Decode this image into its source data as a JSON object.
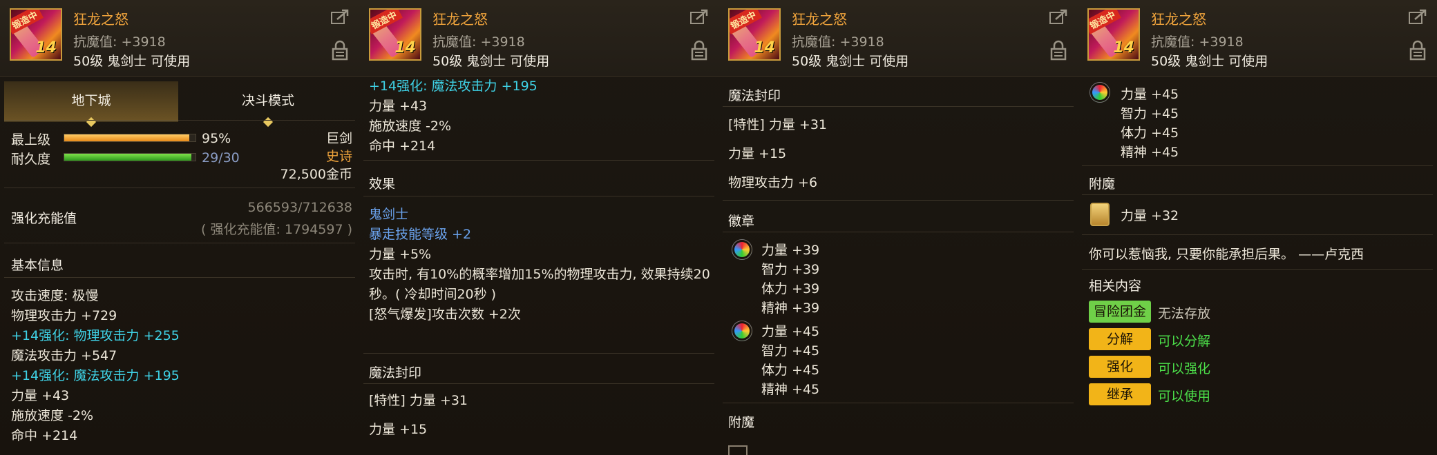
{
  "item": {
    "name": "狂龙之怒",
    "badge": "锻造中",
    "level_overlay": "14",
    "stat": "抗魔值: +3918",
    "requirement": "50级 鬼剑士 可使用"
  },
  "panel1": {
    "tabs": [
      "地下城",
      "决斗模式"
    ],
    "grade_label": "最上级",
    "grade_value": "95%",
    "grade_fraction": 0.95,
    "durability_label": "耐久度",
    "durability_value": "29/30",
    "durability_fraction": 0.967,
    "weapon_type": "巨剑",
    "rarity": "史诗",
    "price": "72,500金币",
    "charge_label": "强化充能值",
    "charge_value": "566593/712638",
    "charge_total": "( 强化充能值: 1794597 )",
    "basic_info_title": "基本信息",
    "lines": [
      {
        "text": "攻击速度: 极慢",
        "color": "white"
      },
      {
        "text": "物理攻击力 +729",
        "color": "white"
      },
      {
        "text": "+14强化: 物理攻击力 +255",
        "color": "cyan"
      },
      {
        "text": "魔法攻击力 +547",
        "color": "white"
      },
      {
        "text": "+14强化: 魔法攻击力 +195",
        "color": "cyan"
      },
      {
        "text": "力量 +43",
        "color": "white"
      },
      {
        "text": "施放速度 -2%",
        "color": "white"
      },
      {
        "text": "命中 +214",
        "color": "white"
      }
    ]
  },
  "panel2": {
    "top_lines": [
      {
        "text": "+14强化: 魔法攻击力 +195",
        "color": "cyan"
      },
      {
        "text": "力量 +43",
        "color": "white"
      },
      {
        "text": "施放速度 -2%",
        "color": "white"
      },
      {
        "text": "命中 +214",
        "color": "white"
      }
    ],
    "effect_title": "效果",
    "effect_class": "鬼剑士",
    "effect_skill": "暴走技能等级 +2",
    "effect_str": "力量 +5%",
    "effect_desc_1": "攻击时, 有10%的概率增加15%的物理攻击力, 效果持续20",
    "effect_desc_2": "秒。( 冷却时间20秒 )",
    "effect_rage": "[怒气爆发]攻击次数 +2次",
    "seal_title": "魔法封印",
    "seal_trait": "[特性] 力量 +31",
    "seal_str": "力量 +15"
  },
  "panel3": {
    "seal_title": "魔法封印",
    "seal_trait": "[特性] 力量 +31",
    "seal_str": "力量 +15",
    "seal_patk": "物理攻击力 +6",
    "emblem_title": "徽章",
    "emblem1": [
      "力量 +39",
      "智力 +39",
      "体力 +39",
      "精神 +39"
    ],
    "emblem2": [
      "力量 +45",
      "智力 +45",
      "体力 +45",
      "精神 +45"
    ],
    "enchant_title": "附魔"
  },
  "panel4": {
    "emblem": [
      "力量 +45",
      "智力 +45",
      "体力 +45",
      "精神 +45"
    ],
    "enchant_title": "附魔",
    "enchant_value": "力量 +32",
    "flavor": "你可以惹恼我, 只要你能承担后果。 ——卢克西",
    "related_title": "相关内容",
    "actions": [
      {
        "label": "冒险团金库",
        "status": "无法存放"
      },
      {
        "label": "分解",
        "status": "可以分解"
      },
      {
        "label": "强化",
        "status": "可以强化"
      },
      {
        "label": "继承",
        "status": "可以使用"
      }
    ]
  },
  "colors": {
    "accent_gold": "#f0a43c",
    "enhance_cyan": "#3fd2e6",
    "class_blue": "#6aa2ec",
    "positive_green": "#4ce04a",
    "tag_green": "#6fd048",
    "tag_gold": "#f2b418"
  },
  "icons": [
    "sword-item-icon",
    "share-icon",
    "lock-icon",
    "orb-emblem-icon",
    "enchant-card-icon"
  ]
}
